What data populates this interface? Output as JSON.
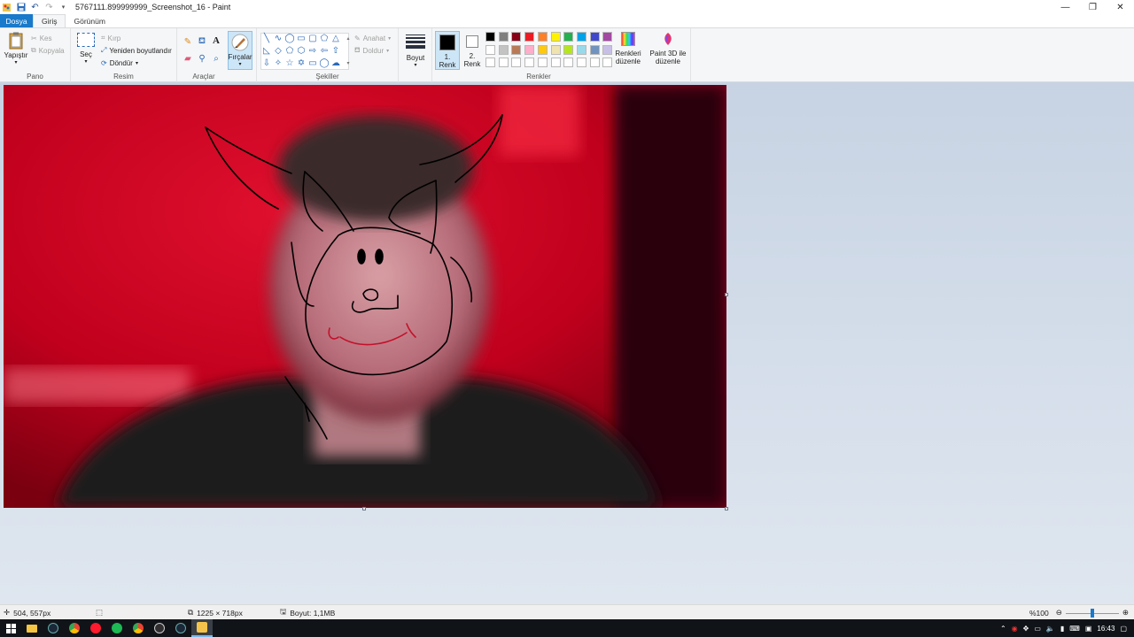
{
  "window": {
    "title": "5767111.899999999_Screenshot_16 - Paint",
    "controls": [
      "minimize",
      "restore",
      "close"
    ]
  },
  "quick_access": [
    "save-icon",
    "undo-icon",
    "redo-icon",
    "customize-icon"
  ],
  "tabs": [
    {
      "label": "Dosya",
      "kind": "file"
    },
    {
      "label": "Giriş",
      "kind": "active"
    },
    {
      "label": "Görünüm",
      "kind": "normal"
    }
  ],
  "ribbon": {
    "clipboard": {
      "group_label": "Pano",
      "paste_label": "Yapıştır",
      "cut_label": "Kes",
      "copy_label": "Kopyala"
    },
    "image": {
      "group_label": "Resim",
      "select_label": "Seç",
      "crop_label": "Kırp",
      "resize_label": "Yeniden boyutlandır",
      "rotate_label": "Döndür"
    },
    "tools": {
      "group_label": "Araçlar",
      "brushes_label": "Fırçalar"
    },
    "shapes": {
      "group_label": "Şekiller",
      "outline_label": "Anahat",
      "fill_label": "Doldur"
    },
    "size": {
      "label": "Boyut"
    },
    "colors": {
      "group_label": "Renkler",
      "color1_label_line1": "1.",
      "color1_label_line2": "Renk",
      "color2_label_line1": "2.",
      "color2_label_line2": "Renk",
      "color1_value": "#000000",
      "color2_value": "#ffffff",
      "edit_colors_line1": "Renkleri",
      "edit_colors_line2": "düzenle",
      "paint3d_line1": "Paint 3D ile",
      "paint3d_line2": "düzenle",
      "palette_row1": [
        "#000000",
        "#7f7f7f",
        "#880015",
        "#ed1c24",
        "#ff7f27",
        "#fff200",
        "#22b14c",
        "#00a2e8",
        "#3f48cc",
        "#a349a4"
      ],
      "palette_row2": [
        "#ffffff",
        "#c3c3c3",
        "#b97a57",
        "#ffaec9",
        "#ffc90e",
        "#efe4b0",
        "#b5e61d",
        "#99d9ea",
        "#7092be",
        "#c8bfe7"
      ],
      "palette_row3": [
        "#ffffff",
        "#ffffff",
        "#ffffff",
        "#ffffff",
        "#ffffff",
        "#ffffff",
        "#ffffff",
        "#ffffff",
        "#ffffff",
        "#ffffff"
      ]
    }
  },
  "status": {
    "cursor_position": "504, 557px",
    "image_size": "1225 × 718px",
    "file_size": "Boyut: 1,1MB",
    "zoom": "%100"
  },
  "taskbar": {
    "apps": [
      "windows-start",
      "file-explorer",
      "steam",
      "chrome",
      "opera",
      "spotify",
      "chrome-2",
      "obs",
      "steam-2",
      "paint"
    ],
    "clock": "16:43"
  }
}
